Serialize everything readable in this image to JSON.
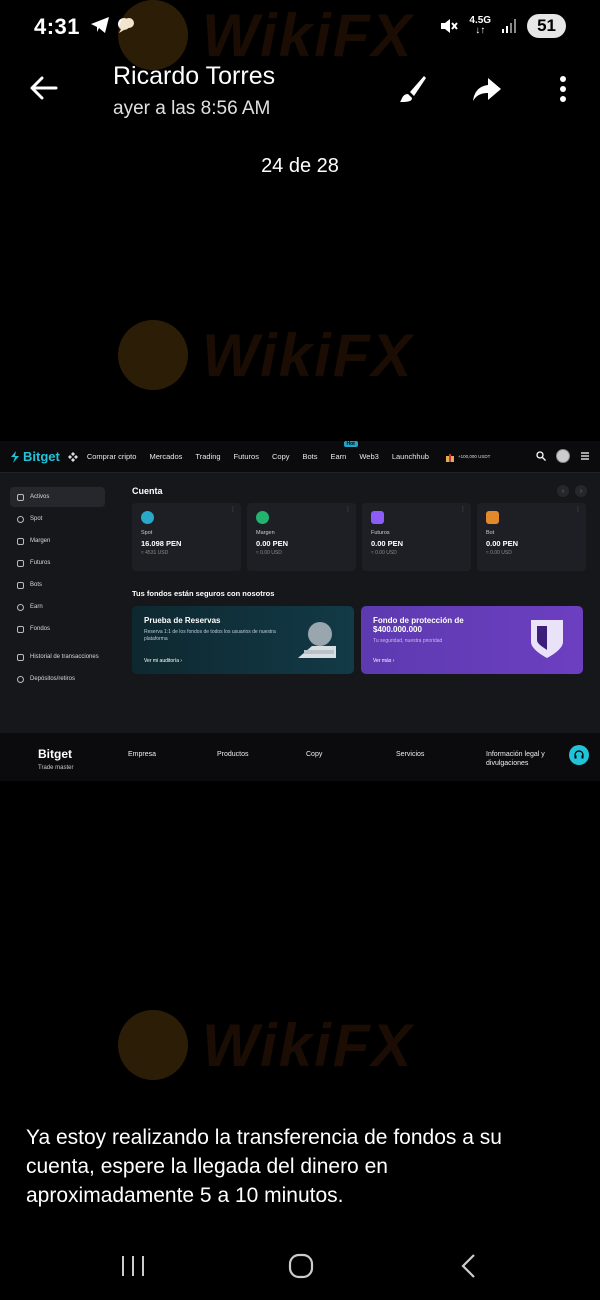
{
  "status_bar": {
    "time": "4:31",
    "network_type": "4.5G",
    "battery": "51"
  },
  "viewer": {
    "sender_name": "Ricardo Torres",
    "timestamp": "ayer a las 8:56 AM",
    "counter": "24 de 28"
  },
  "watermark": {
    "text": "WikiFX"
  },
  "screenshot": {
    "brand": "Bitget",
    "nav_items": [
      "Comprar cripto",
      "Mercados",
      "Trading",
      "Futuros",
      "Copy",
      "Bots",
      "Earn",
      "Web3",
      "Launchhub"
    ],
    "earn_badge": "Hot",
    "promo": "+100,000 USDT",
    "sidebar": [
      "Activos",
      "Spot",
      "Margen",
      "Futuros",
      "Bots",
      "Earn",
      "Fondos",
      "Historial de transacciones",
      "Depósitos/retiros"
    ],
    "section_title": "Cuenta",
    "cards": [
      {
        "label": "Spot",
        "value": "16.098 PEN",
        "sub": "≈ 4531 USD",
        "color": "#2aa8c9"
      },
      {
        "label": "Margen",
        "value": "0.00 PEN",
        "sub": "≈ 0.00 USD",
        "color": "#22b36e"
      },
      {
        "label": "Futuros",
        "value": "0.00 PEN",
        "sub": "≈ 0.00 USD",
        "color": "#8b5cf6"
      },
      {
        "label": "Bot",
        "value": "0.00 PEN",
        "sub": "≈ 0.00 USD",
        "color": "#e28a2b"
      }
    ],
    "safe_title": "Tus fondos están seguros con nosotros",
    "reserves": {
      "title": "Prueba de Reservas",
      "desc": "Reserva 1:1 de los fondos de todos los usuarios de nuestra plataforma",
      "link": "Ver mi auditoría ›"
    },
    "fund": {
      "title": "Fondo de protección de $400.000.000",
      "desc": "Tu seguridad, nuestra prioridad",
      "link": "Ver más ›"
    },
    "footer": {
      "brand": "Bitget",
      "tagline": "Trade master",
      "columns": [
        "Empresa",
        "Productos",
        "Copy",
        "Servicios",
        "Información legal y divulgaciones"
      ]
    }
  },
  "caption": "Ya estoy realizando la transferencia de fondos a su cuenta, espere la llegada del dinero en aproximadamente 5 a 10 minutos."
}
